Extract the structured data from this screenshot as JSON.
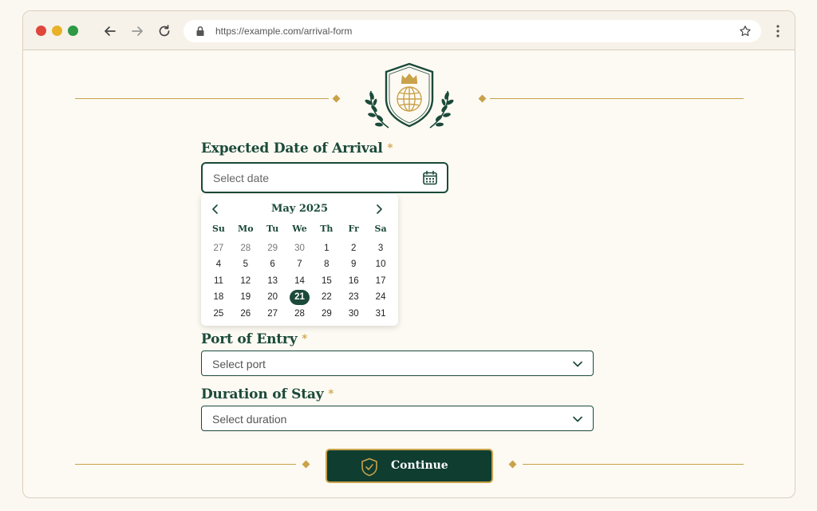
{
  "browser": {
    "url": "https://example.com/arrival-form",
    "icons": [
      "back-arrow-icon",
      "forward-arrow-icon",
      "reload-icon",
      "lock-icon",
      "star-icon",
      "kebab-menu-icon"
    ]
  },
  "form": {
    "arrival": {
      "label": "Expected Date of Arrival",
      "required_mark": "*",
      "placeholder": "Select date"
    },
    "calendar": {
      "month_label": "May 2025",
      "weekdays": [
        "Su",
        "Mo",
        "Tu",
        "We",
        "Th",
        "Fr",
        "Sa"
      ],
      "weeks": [
        [
          "27",
          "28",
          "29",
          "30",
          "1",
          "2",
          "3"
        ],
        [
          "4",
          "5",
          "6",
          "7",
          "8",
          "9",
          "10"
        ],
        [
          "11",
          "12",
          "13",
          "14",
          "15",
          "16",
          "17"
        ],
        [
          "18",
          "19",
          "20",
          "21",
          "22",
          "23",
          "24"
        ],
        [
          "25",
          "26",
          "27",
          "28",
          "29",
          "30",
          "31"
        ]
      ],
      "selected_day": "21"
    },
    "port": {
      "label": "Port of Entry",
      "required_mark": "*",
      "placeholder": "Select port"
    },
    "duration": {
      "label": "Duration of Stay",
      "required_mark": "*",
      "placeholder": "Select duration"
    },
    "continue_label": "Continue"
  },
  "colors": {
    "brand_green": "#1b4a3a",
    "accent_gold": "#c9a24a",
    "background": "#fdfaf3"
  }
}
